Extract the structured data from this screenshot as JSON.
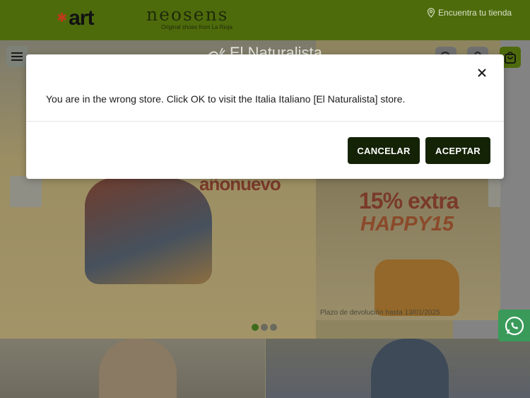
{
  "brands": {
    "art": "art",
    "neosens": "neosens",
    "neosens_tagline": "Original shoes from La Rioja"
  },
  "store_link": {
    "label": "Encuentra tu tienda"
  },
  "navbar": {
    "logo_text": "El Naturalista"
  },
  "hero": {
    "slide_text": "añonuevo",
    "promo_line1": "15% extra",
    "promo_line2": "HAPPY15",
    "return_note": "Plazo de devolución hasta 13/01/2025",
    "slide_count": 3,
    "active_slide": 1
  },
  "modal": {
    "message": "You are in the wrong store. Click OK to visit the Italia Italiano [El Naturalista] store.",
    "cancel_label": "CANCELAR",
    "accept_label": "ACEPTAR"
  },
  "colors": {
    "brand_green": "#4e6b0c",
    "button_dark": "#142206",
    "whatsapp": "#3a9a5a"
  }
}
